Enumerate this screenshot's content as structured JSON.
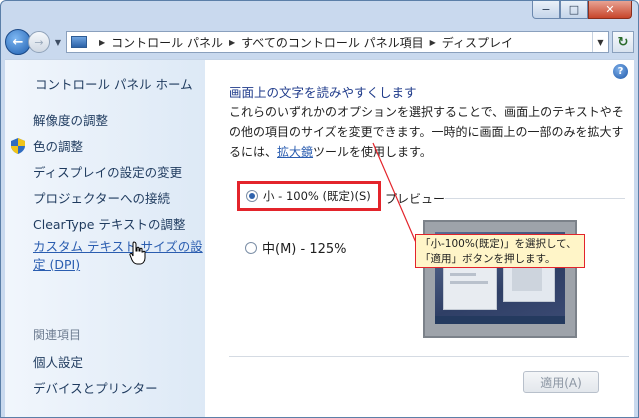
{
  "window": {
    "caption_minimize": "−",
    "caption_maximize": "□",
    "caption_close": "✕"
  },
  "address_bar": {
    "back_glyph": "←",
    "forward_glyph": "→",
    "breadcrumbs": [
      "コントロール パネル",
      "すべてのコントロール パネル項目",
      "ディスプレイ"
    ],
    "refresh_glyph": "↻"
  },
  "left_pane": {
    "home": "コントロール パネル ホーム",
    "items": [
      "解像度の調整",
      "色の調整",
      "ディスプレイの設定の変更",
      "プロジェクターへの接続",
      "ClearType テキストの調整"
    ],
    "custom_text_link": "カスタム テキスト サイズの設定 (DPI)",
    "related_heading": "関連項目",
    "related_items": [
      "個人設定",
      "デバイスとプリンター"
    ]
  },
  "main": {
    "help_glyph": "?",
    "heading": "画面上の文字を読みやすくします",
    "description_before": "これらのいずれかのオプションを選択することで、画面上のテキストやその他の項目のサイズを変更できます。一時的に画面上の一部のみを拡大するには、",
    "description_link": "拡大鏡",
    "description_after": "ツールを使用します。",
    "option_small": "小 - 100% (既定)(S)",
    "option_medium": "中(M) - 125%",
    "preview_label": "プレビュー",
    "apply_button": "適用(A)"
  },
  "callout": {
    "line1": "「小-100%(既定)」を選択して、",
    "line2": "「適用」ボタンを押します。"
  },
  "colors": {
    "highlight_red": "#e3242b",
    "callout_bg": "#fff5c8",
    "link_blue": "#2a5db0"
  }
}
